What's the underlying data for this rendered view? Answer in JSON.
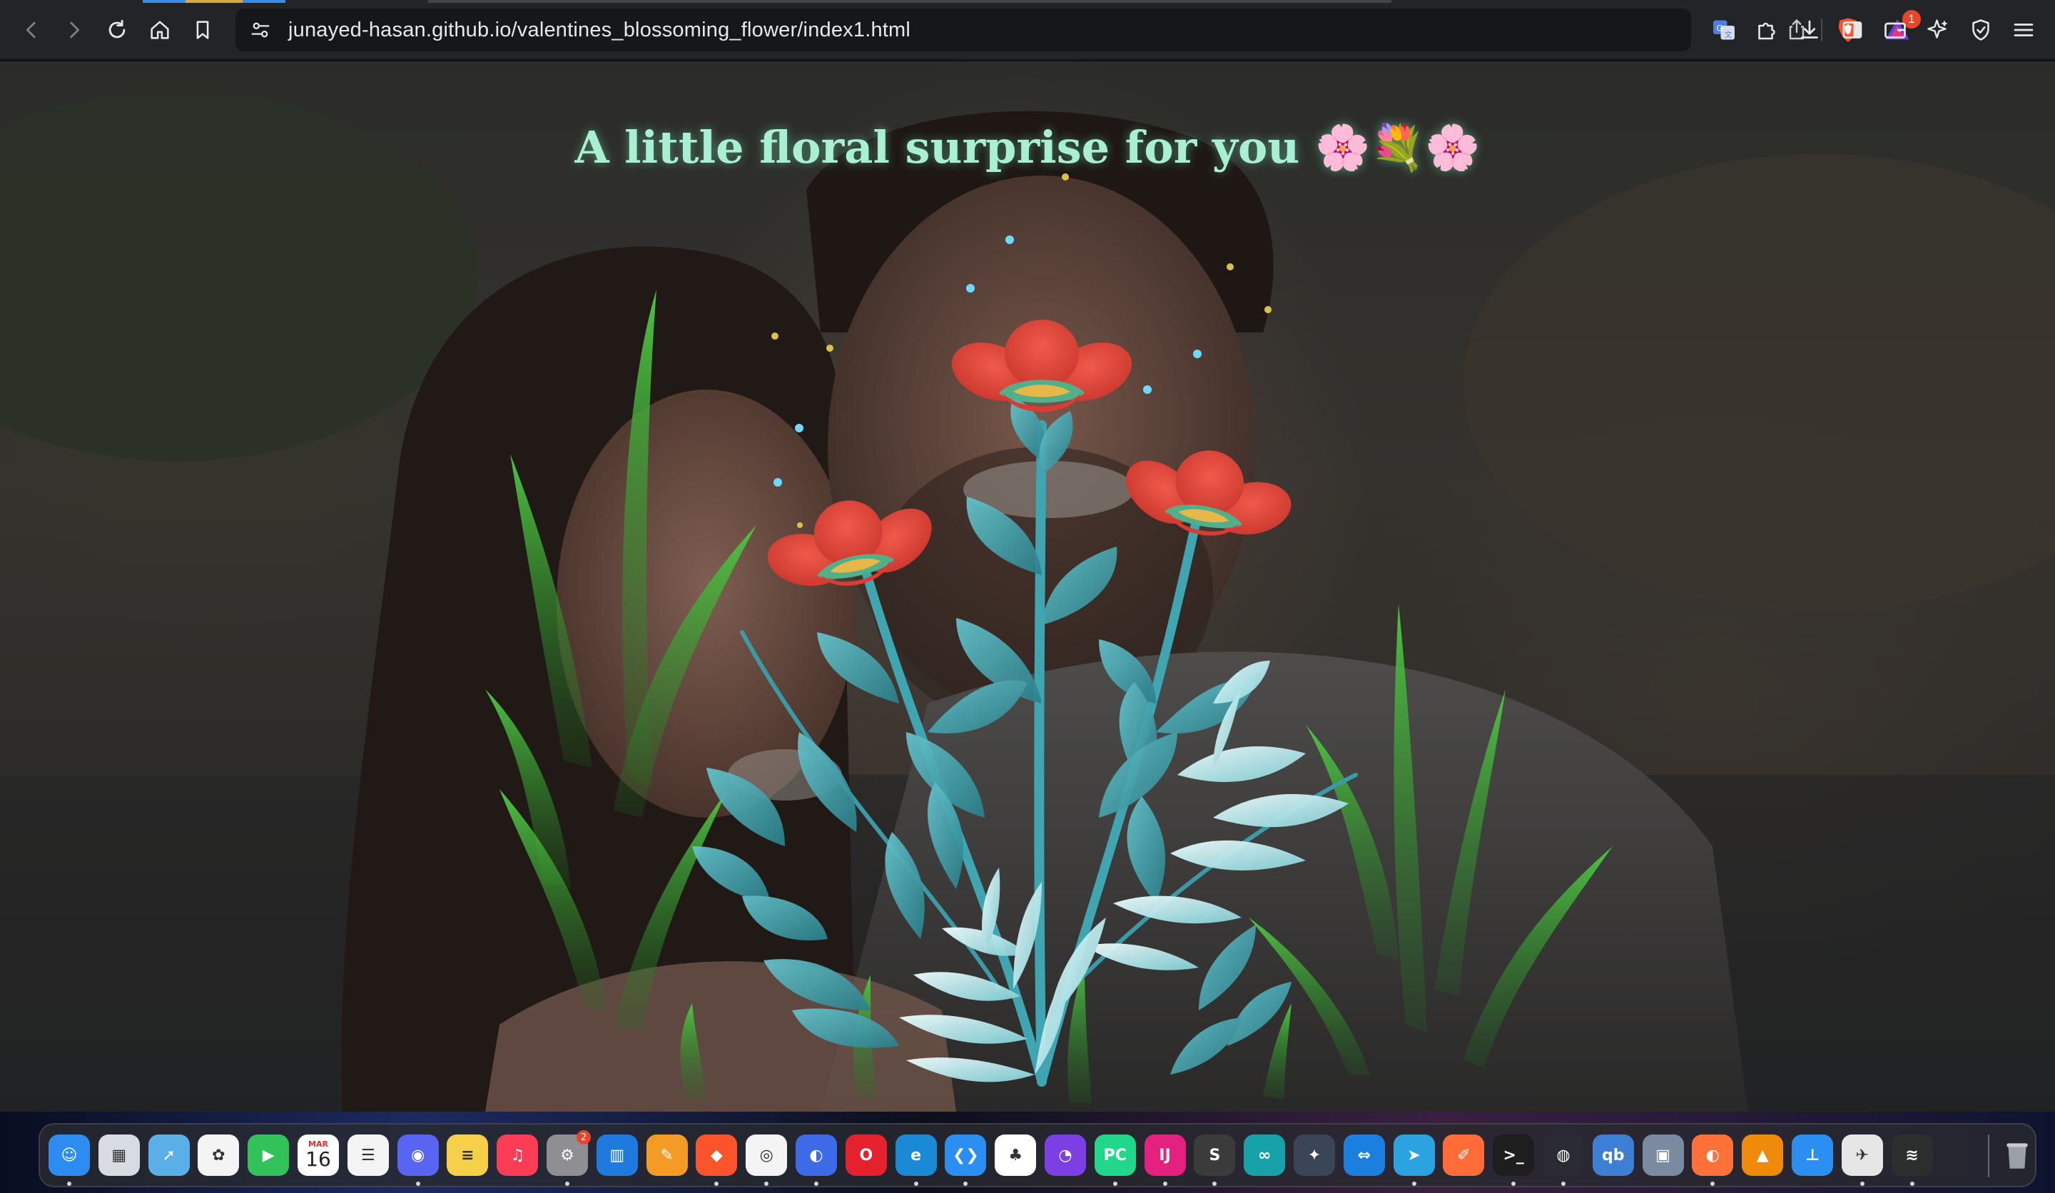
{
  "browser": {
    "url": "junayed-hasan.github.io/valentines_blossoming_flower/index1.html",
    "rewards_badge": "1",
    "accent": "#e8462b"
  },
  "page": {
    "headline": "A little floral surprise for you 🌸💐🌸",
    "headline_color": "#a9f0d2",
    "petal_color": "#e0453a",
    "leaf_color": "#4fb3bd",
    "grass_color": "#3fae3a"
  },
  "dock": {
    "calendar_month": "MAR",
    "calendar_day": "16",
    "settings_badge": "2",
    "apps": [
      {
        "name": "finder-icon",
        "color": "#2d8cf0"
      },
      {
        "name": "launchpad-icon",
        "color": "#d7dbe2"
      },
      {
        "name": "maps-icon",
        "color": "#5ab0e6"
      },
      {
        "name": "photos-icon",
        "color": "#f4f4f4"
      },
      {
        "name": "facetime-icon",
        "color": "#32c25a"
      },
      {
        "name": "calendar-icon",
        "color": "#ffffff"
      },
      {
        "name": "reminders-icon",
        "color": "#f4f4f4"
      },
      {
        "name": "discord-icon",
        "color": "#5865f2"
      },
      {
        "name": "notes-icon",
        "color": "#f7d04a"
      },
      {
        "name": "music-icon",
        "color": "#fa3c55"
      },
      {
        "name": "system-settings-icon",
        "color": "#8e8e93"
      },
      {
        "name": "trello-icon",
        "color": "#1f7ae0"
      },
      {
        "name": "pages-icon",
        "color": "#f49b25"
      },
      {
        "name": "brave-icon",
        "color": "#fb542b"
      },
      {
        "name": "chrome-icon",
        "color": "#f4f4f4"
      },
      {
        "name": "firefox-dev-icon",
        "color": "#3d6be8"
      },
      {
        "name": "opera-icon",
        "color": "#e5212e"
      },
      {
        "name": "edge-icon",
        "color": "#1a8ad6"
      },
      {
        "name": "vscode-icon",
        "color": "#2a8ff0"
      },
      {
        "name": "mongodb-compass-icon",
        "color": "#ffffff"
      },
      {
        "name": "github-desktop-icon",
        "color": "#7b3fe4"
      },
      {
        "name": "pycharm-icon",
        "color": "#21d789"
      },
      {
        "name": "intellij-icon",
        "color": "#e4217e"
      },
      {
        "name": "sublime-text-icon",
        "color": "#3b3b3b"
      },
      {
        "name": "arduino-icon",
        "color": "#16a2a8"
      },
      {
        "name": "davinci-resolve-icon",
        "color": "#3a4555"
      },
      {
        "name": "teamviewer-icon",
        "color": "#1b7fe0"
      },
      {
        "name": "telegram-icon",
        "color": "#2aa3e0"
      },
      {
        "name": "postman-icon",
        "color": "#ff6c37"
      },
      {
        "name": "terminal-icon",
        "color": "#1e1e1e"
      },
      {
        "name": "obs-icon",
        "color": "#2b2b35"
      },
      {
        "name": "qbittorrent-icon",
        "color": "#3e7fd6"
      },
      {
        "name": "preview-icon",
        "color": "#7a8aa0"
      },
      {
        "name": "firefox-icon",
        "color": "#ff7139"
      },
      {
        "name": "vlc-icon",
        "color": "#f08a0a"
      },
      {
        "name": "keynote-icon",
        "color": "#2b8ff2"
      },
      {
        "name": "python-launcher-icon",
        "color": "#e6e6e6"
      },
      {
        "name": "app-icon",
        "color": "#2a2f2e"
      }
    ]
  }
}
